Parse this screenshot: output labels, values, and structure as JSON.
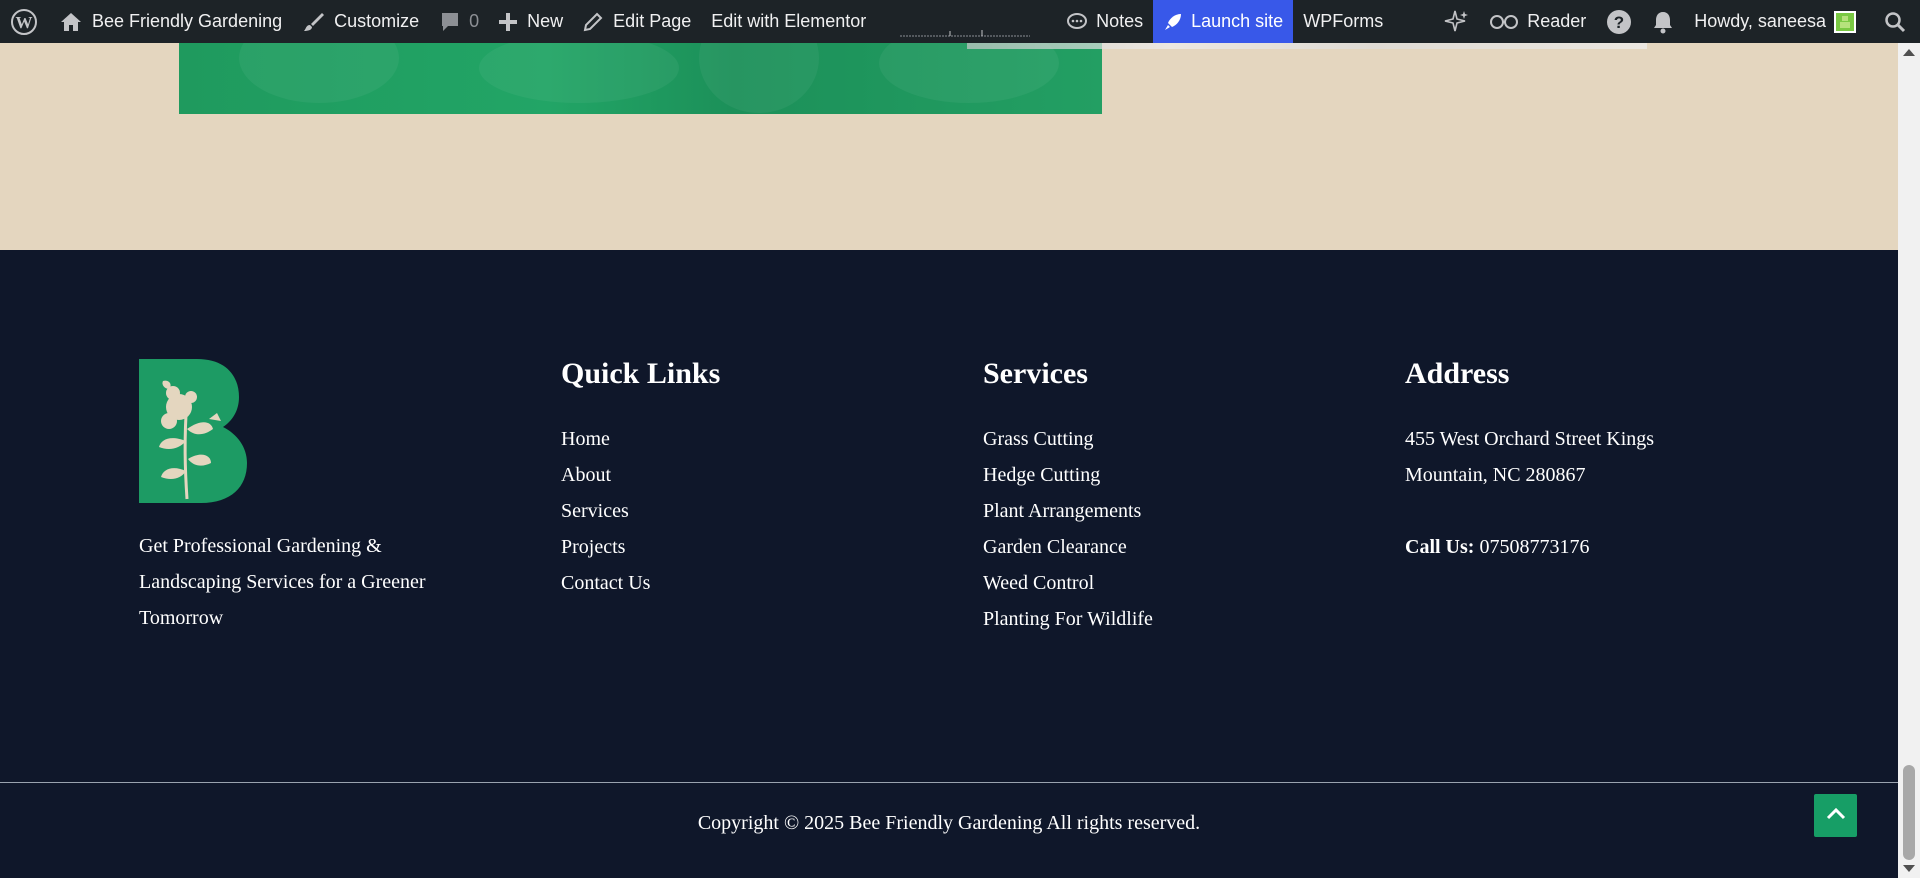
{
  "adminbar": {
    "site_name": "Bee Friendly Gardening",
    "customize": "Customize",
    "comments_count": "0",
    "new": "New",
    "edit_page": "Edit Page",
    "edit_elementor": "Edit with Elementor",
    "notes": "Notes",
    "launch_site": "Launch site",
    "wpforms": "WPForms",
    "reader": "Reader",
    "howdy": "Howdy, saneesa"
  },
  "footer": {
    "tagline": "Get Professional Gardening & Landscaping Services for a Greener Tomorrow",
    "quick_links": {
      "title": "Quick Links",
      "items": [
        "Home",
        "About",
        "Services",
        "Projects",
        "Contact Us"
      ]
    },
    "services": {
      "title": "Services",
      "items": [
        "Grass Cutting",
        "Hedge Cutting",
        "Plant Arrangements",
        "Garden Clearance",
        "Weed Control",
        "Planting For Wildlife"
      ]
    },
    "address": {
      "title": "Address",
      "text": "455 West Orchard Street Kings Mountain, NC 280867",
      "call_label": "Call Us:",
      "phone": "07508773176"
    },
    "copyright": "Copyright © 2025 Bee Friendly Gardening All rights reserved."
  },
  "colors": {
    "adminbar_bg": "#1d2327",
    "launch_bg": "#3858e9",
    "footer_bg": "#0f172a",
    "upper_bg": "#e4d6bf",
    "accent_green": "#179e66"
  }
}
